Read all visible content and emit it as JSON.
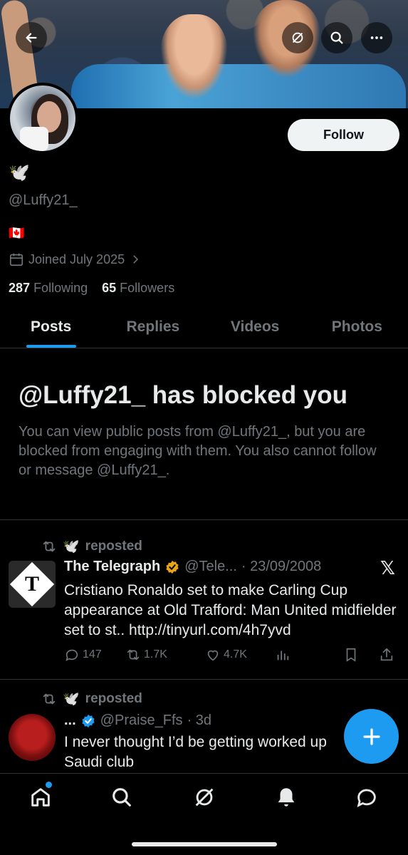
{
  "profile": {
    "follow_label": "Follow",
    "display_emoji": "🕊️",
    "handle": "@Luffy21_",
    "flag": "🇨🇦",
    "joined": "Joined July 2025",
    "following_count": "287",
    "following_label": "Following",
    "followers_count": "65",
    "followers_label": "Followers"
  },
  "tabs": [
    {
      "label": "Posts",
      "active": true
    },
    {
      "label": "Replies",
      "active": false
    },
    {
      "label": "Videos",
      "active": false
    },
    {
      "label": "Photos",
      "active": false
    }
  ],
  "blocked": {
    "title": "@Luffy21_ has blocked you",
    "description": "You can view public posts from @Luffy21_, but you are blocked from engaging with them. You also cannot follow or message @Luffy21_."
  },
  "posts": [
    {
      "repost_emoji": "🕊️",
      "repost_label": "reposted",
      "name": "The Telegraph",
      "handle": "@Tele...",
      "date": "· 23/09/2008",
      "text": "Cristiano Ronaldo set to make Carling Cup appearance at Old Trafford: Man United midfielder set to st.. http://tinyurl.com/4h7yvd",
      "replies": "147",
      "reposts": "1.7K",
      "likes": "4.7K",
      "avatar_letter": "T"
    },
    {
      "repost_emoji": "🕊️",
      "repost_label": "reposted",
      "name": "...",
      "handle": "@Praise_Ffs",
      "date": "· 3d",
      "text": "I never thought I’d be getting worked up Saudi club"
    }
  ],
  "colors": {
    "accent": "#1d9bf0",
    "verified_gold": "#e8a317",
    "verified_blue": "#1d9bf0",
    "muted": "#71767b"
  },
  "icons": {
    "back": "back-arrow-icon",
    "grok": "grok-icon",
    "search": "search-icon",
    "more": "more-icon",
    "calendar": "calendar-icon",
    "repost": "repost-icon",
    "x_logo": "x-logo-icon",
    "fab": "plus-icon",
    "nav": [
      "home-icon",
      "search-icon",
      "grok-icon",
      "bell-icon",
      "chat-icon"
    ]
  }
}
